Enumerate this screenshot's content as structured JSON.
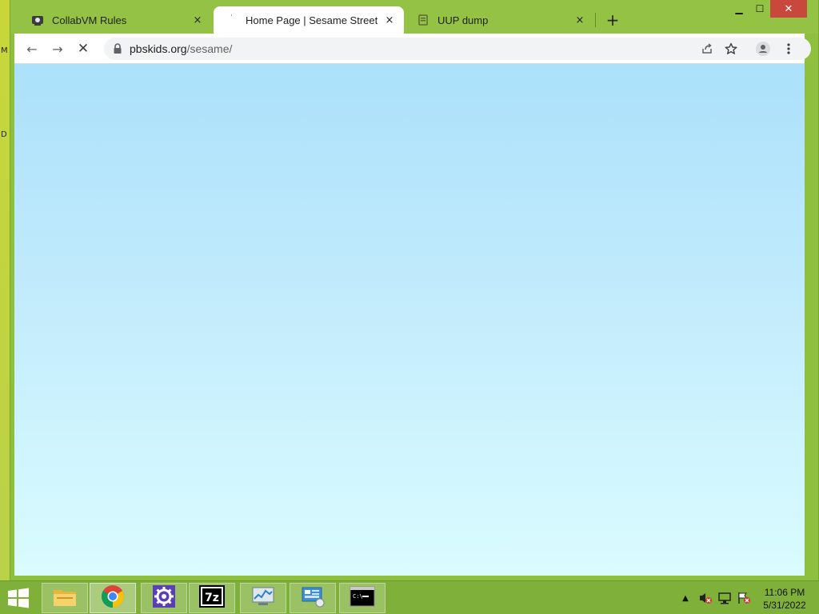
{
  "desktop": {
    "edge_labels": [
      "M",
      "D"
    ]
  },
  "browser": {
    "tabs": [
      {
        "title": "CollabVM Rules",
        "favicon": "collabvm-icon",
        "close": "×",
        "active": false
      },
      {
        "title": "Home Page | Sesame Street | PBS KIDS",
        "favicon": "loading-icon",
        "close": "×",
        "active": true
      },
      {
        "title": "UUP dump",
        "favicon": "uup-icon",
        "close": "×",
        "active": false
      }
    ],
    "new_tab_label": "+",
    "window_controls": {
      "minimize": "▁",
      "maximize": "☐",
      "close": "✕"
    },
    "toolbar": {
      "back": "←",
      "forward": "→",
      "stop": "✕"
    },
    "address": {
      "host": "pbskids.org",
      "path": "/sesame/"
    }
  },
  "taskbar": {
    "clock_time": "11:06 PM",
    "clock_date": "5/31/2022",
    "tray_overflow": "▲",
    "colors": {
      "accent": "#7fb03a"
    }
  }
}
